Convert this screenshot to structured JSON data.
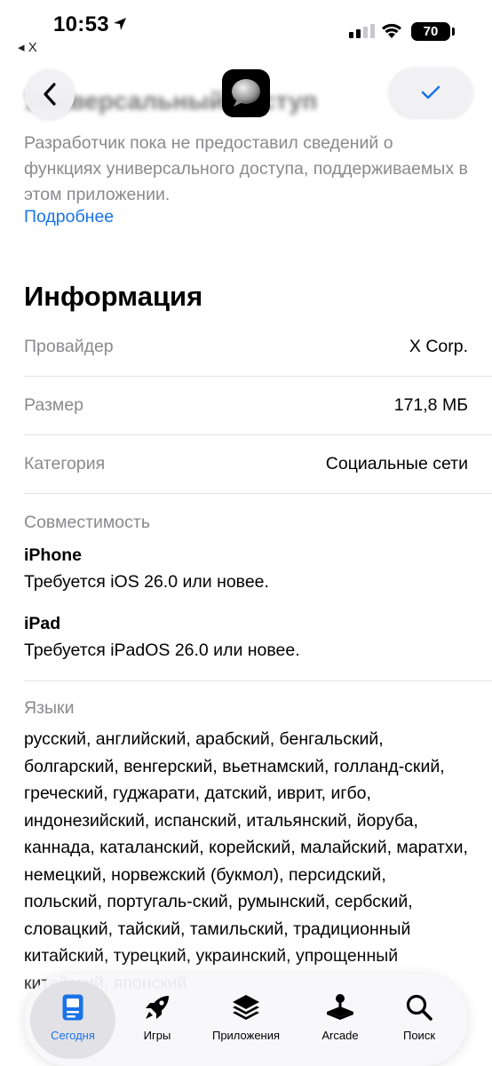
{
  "status_bar": {
    "time": "10:53",
    "back_app": "◂ X",
    "battery": "70"
  },
  "nav": {
    "heading_blurred": "Универсальный доступ"
  },
  "accessibility": {
    "description": "Разработчик пока не предоставил сведений о функциях универсального доступа, поддерживаемых в этом приложении.",
    "more_link": "Подробнее"
  },
  "information": {
    "title": "Информация",
    "rows": [
      {
        "label": "Провайдер",
        "value": "X Corp."
      },
      {
        "label": "Размер",
        "value": "171,8 МБ"
      },
      {
        "label": "Категория",
        "value": "Социальные сети"
      }
    ],
    "compatibility": {
      "label": "Совместимость",
      "devices": [
        {
          "name": "iPhone",
          "requirement": "Требуется iOS 26.0 или новее."
        },
        {
          "name": "iPad",
          "requirement": "Требуется iPadOS 26.0 или новее."
        }
      ]
    },
    "languages": {
      "label": "Языки",
      "text": "русский, английский, арабский, бенгальский, болгарский, венгерский, вьетнамский, голланд-ский, греческий, гуджарати, датский, иврит, игбо, индонезийский, испанский, итальянский, йоруба, каннада, каталанский, корейский, малайский, маратхи, немецкий, норвежский (букмол), персидский, польский, португаль-ский, румынский, сербский, словацкий, тайский, тамильский, традиционный китайский, турецкий, украинский, упрощенный китайский, японский"
    }
  },
  "tab_bar": {
    "tabs": [
      {
        "label": "Сегодня",
        "icon": "today-icon",
        "active": true
      },
      {
        "label": "Игры",
        "icon": "rocket-icon",
        "active": false
      },
      {
        "label": "Приложения",
        "icon": "layers-icon",
        "active": false
      },
      {
        "label": "Arcade",
        "icon": "joystick-icon",
        "active": false
      },
      {
        "label": "Поиск",
        "icon": "search-icon",
        "active": false
      }
    ]
  },
  "colors": {
    "accent": "#1a73e8",
    "secondary_text": "#8a8a8e"
  }
}
